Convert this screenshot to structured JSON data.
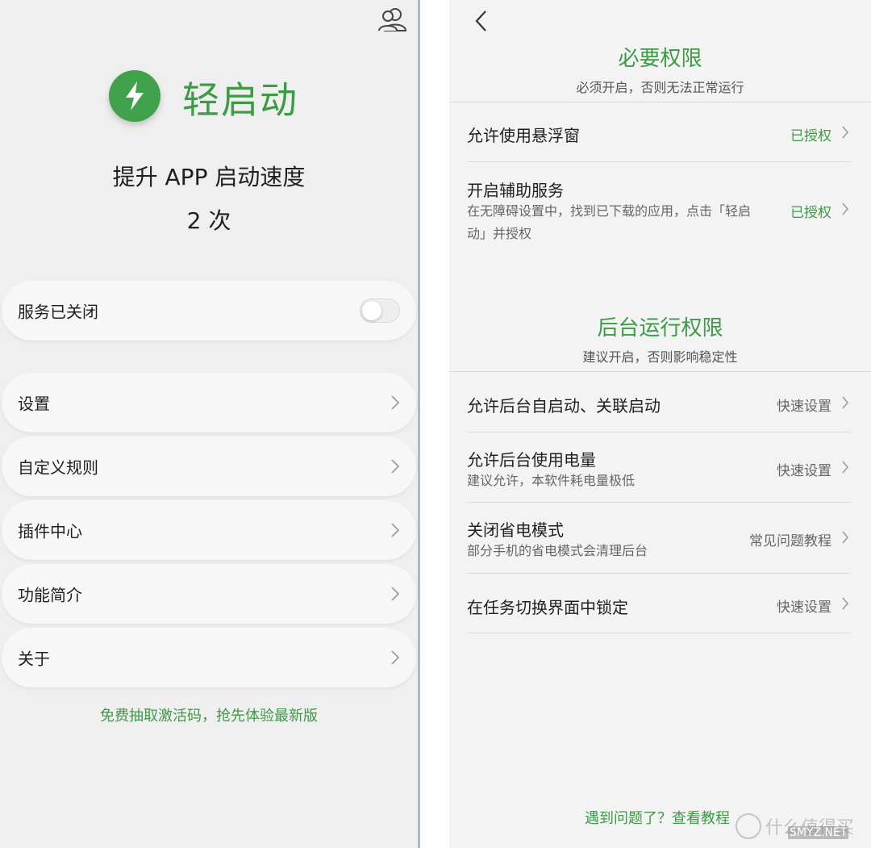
{
  "left": {
    "app_name": "轻启动",
    "tagline": "提升 APP 启动速度",
    "count": "2 次",
    "service": {
      "label": "服务已关闭",
      "enabled": false
    },
    "menu": [
      {
        "label": "设置"
      },
      {
        "label": "自定义规则"
      },
      {
        "label": "插件中心"
      },
      {
        "label": "功能简介"
      },
      {
        "label": "关于"
      }
    ],
    "promo": "免费抽取激活码，抢先体验最新版",
    "colors": {
      "accent": "#3d9a45",
      "icon_bg": "#3fa24a"
    }
  },
  "right": {
    "required": {
      "title": "必要权限",
      "subtitle": "必须开启，否则无法正常运行",
      "items": [
        {
          "title": "允许使用悬浮窗",
          "status": "已授权"
        },
        {
          "title": "开启辅助服务",
          "desc_line1": "在无障碍设置中，找到已下载的应用，点击「轻启",
          "desc_line2": "动」并授权",
          "status": "已授权"
        }
      ]
    },
    "background": {
      "title": "后台运行权限",
      "subtitle": "建议开启，否则影响稳定性",
      "items": [
        {
          "title": "允许后台自启动、关联启动",
          "status": "快速设置"
        },
        {
          "title": "允许后台使用电量",
          "desc": "建议允许，本软件耗电量极低",
          "status": "快速设置"
        },
        {
          "title": "关闭省电模式",
          "desc": "部分手机的省电模式会清理后台",
          "status": "常见问题教程"
        },
        {
          "title": "在任务切换界面中锁定",
          "status": "快速设置"
        }
      ]
    },
    "help": "遇到问题了？查看教程",
    "watermark": {
      "text": "什么值得买",
      "sub": "SMYZ.NET"
    }
  }
}
